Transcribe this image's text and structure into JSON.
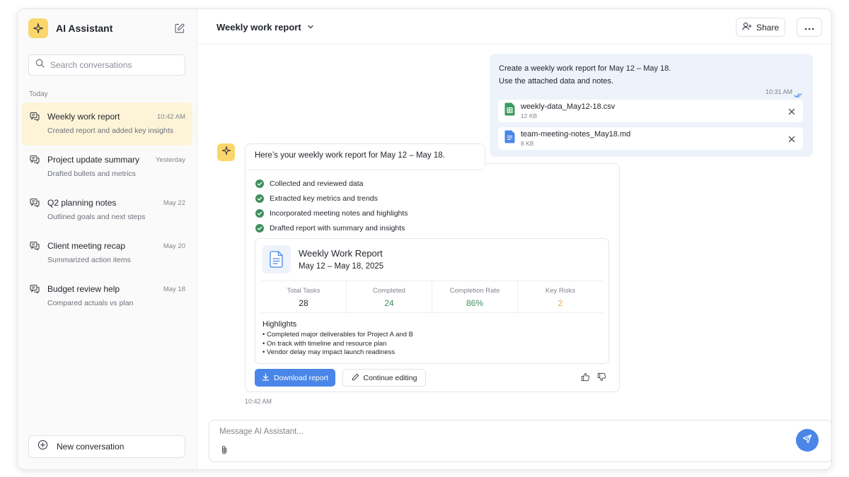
{
  "sidebar": {
    "brand": "AI Assistant",
    "search_placeholder": "Search conversations",
    "section": "Today",
    "conversations": [
      {
        "title": "Weekly work report",
        "time": "10:42 AM",
        "subtitle": "Created report and added key insights",
        "active": true
      },
      {
        "title": "Project update summary",
        "time": "Yesterday",
        "subtitle": "Drafted bullets and metrics"
      },
      {
        "title": "Q2 planning notes",
        "time": "May 22",
        "subtitle": "Outlined goals and next steps"
      },
      {
        "title": "Client meeting recap",
        "time": "May 20",
        "subtitle": "Summarized action items"
      },
      {
        "title": "Budget review help",
        "time": "May 18",
        "subtitle": "Compared actuals vs plan"
      }
    ],
    "new_conversation": "New conversation"
  },
  "header": {
    "title": "Weekly work report",
    "share": "Share"
  },
  "user_message": {
    "line1": "Create a weekly work report for May 12 – May 18.",
    "line2": "Use the attached data and notes.",
    "time": "10:31 AM",
    "attachments": [
      {
        "name": "weekly-data_May12-18.csv",
        "size": "12 KB",
        "icon": "spreadsheet-icon"
      },
      {
        "name": "team-meeting-notes_May18.md",
        "size": "8 KB",
        "icon": "document-icon"
      }
    ]
  },
  "assistant": {
    "intro": "Here’s your weekly work report for May 12 – May 18.",
    "steps": [
      "Collected and reviewed data",
      "Extracted key metrics and trends",
      "Incorporated meeting notes and highlights",
      "Drafted report with summary and insights"
    ],
    "report": {
      "title": "Weekly Work Report",
      "range": "May 12 – May 18, 2025",
      "stats": [
        {
          "label": "Total Tasks",
          "value": "28",
          "color": "#1f2329"
        },
        {
          "label": "Completed",
          "value": "24",
          "color": "#3f8f5d"
        },
        {
          "label": "Completion Rate",
          "value": "86%",
          "color": "#3f8f5d"
        },
        {
          "label": "Key Risks",
          "value": "2",
          "color": "#e9a93a"
        }
      ],
      "highlights_title": "Highlights",
      "highlights": [
        "• Completed major deliverables for Project A and B",
        "• On track with timeline and resource plan",
        "• Vendor delay may impact launch readiness"
      ]
    },
    "download": "Download report",
    "continue": "Continue editing",
    "time": "10:42 AM"
  },
  "composer": {
    "placeholder": "Message AI Assistant..."
  },
  "colors": {
    "accent": "#4a86e8",
    "brand": "#fbd66b",
    "success": "#3f8f5d"
  }
}
